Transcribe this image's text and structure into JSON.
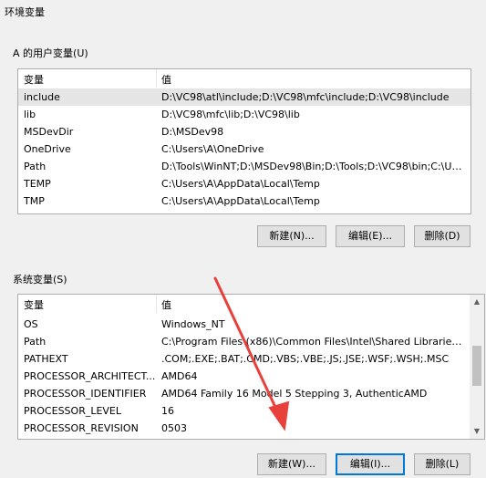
{
  "window": {
    "title": "环境变量"
  },
  "user_section": {
    "label": "A 的用户变量(U)",
    "col_variable": "变量",
    "col_value": "值",
    "rows": [
      {
        "name": "include",
        "value": "D:\\VC98\\atl\\include;D:\\VC98\\mfc\\include;D:\\VC98\\include"
      },
      {
        "name": "lib",
        "value": "D:\\VC98\\mfc\\lib;D:\\VC98\\lib"
      },
      {
        "name": "MSDevDir",
        "value": "D:\\MSDev98"
      },
      {
        "name": "OneDrive",
        "value": "C:\\Users\\A\\OneDrive"
      },
      {
        "name": "Path",
        "value": "D:\\Tools\\WinNT;D:\\MSDev98\\Bin;D:\\Tools;D:\\VC98\\bin;C:\\Use..."
      },
      {
        "name": "TEMP",
        "value": "C:\\Users\\A\\AppData\\Local\\Temp"
      },
      {
        "name": "TMP",
        "value": "C:\\Users\\A\\AppData\\Local\\Temp"
      }
    ],
    "buttons": {
      "new": "新建(N)...",
      "edit": "编辑(E)...",
      "delete": "删除(D)"
    }
  },
  "system_section": {
    "label": "系统变量(S)",
    "col_variable": "变量",
    "col_value": "值",
    "rows": [
      {
        "name": "OS",
        "value": "Windows_NT"
      },
      {
        "name": "Path",
        "value": "C:\\Program Files (x86)\\Common Files\\Intel\\Shared Libraries\\r..."
      },
      {
        "name": "PATHEXT",
        "value": ".COM;.EXE;.BAT;.CMD;.VBS;.VBE;.JS;.JSE;.WSF;.WSH;.MSC"
      },
      {
        "name": "PROCESSOR_ARCHITECT...",
        "value": "AMD64"
      },
      {
        "name": "PROCESSOR_IDENTIFIER",
        "value": "AMD64 Family 16 Model 5 Stepping 3, AuthenticAMD"
      },
      {
        "name": "PROCESSOR_LEVEL",
        "value": "16"
      },
      {
        "name": "PROCESSOR_REVISION",
        "value": "0503"
      }
    ],
    "buttons": {
      "new": "新建(W)...",
      "edit": "编辑(I)...",
      "delete": "删除(L)"
    }
  },
  "colors": {
    "annotation_arrow": "#e8403a",
    "default_button_border": "#0078d7",
    "selected_row": "#e5e5e5"
  }
}
